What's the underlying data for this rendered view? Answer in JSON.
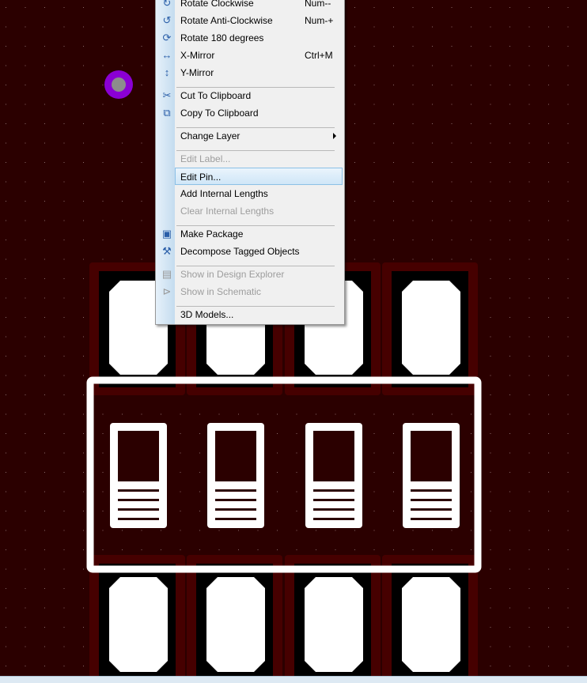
{
  "colors": {
    "background": "#2b0000",
    "pad_outer": "#460000",
    "pad_mask": "#000000",
    "copper": "#ffffff",
    "via": "#8a00d4",
    "via_hole": "#8c8c8c",
    "grid_dot": "#8a6a6a"
  },
  "context_menu": {
    "items": [
      {
        "label": "Rotate Clockwise",
        "shortcut": "Num--",
        "icon": "rotate-clockwise-icon",
        "enabled": true
      },
      {
        "label": "Rotate Anti-Clockwise",
        "shortcut": "Num-+",
        "icon": "rotate-anticlockwise-icon",
        "enabled": true
      },
      {
        "label": "Rotate 180 degrees",
        "shortcut": "",
        "icon": "rotate-180-icon",
        "enabled": true
      },
      {
        "label": "X-Mirror",
        "shortcut": "Ctrl+M",
        "icon": "x-mirror-icon",
        "enabled": true
      },
      {
        "label": "Y-Mirror",
        "shortcut": "",
        "icon": "y-mirror-icon",
        "enabled": true
      },
      {
        "label": "Cut To Clipboard",
        "shortcut": "",
        "icon": "scissors-icon",
        "enabled": true
      },
      {
        "label": "Copy To Clipboard",
        "shortcut": "",
        "icon": "copy-icon",
        "enabled": true
      },
      {
        "label": "Change Layer",
        "shortcut": "",
        "icon": "",
        "enabled": true,
        "submenu": true
      },
      {
        "label": "Edit Label...",
        "shortcut": "",
        "icon": "",
        "enabled": false
      },
      {
        "label": "Edit Pin...",
        "shortcut": "",
        "icon": "",
        "enabled": true,
        "highlighted": true
      },
      {
        "label": "Add Internal Lengths",
        "shortcut": "",
        "icon": "",
        "enabled": true
      },
      {
        "label": "Clear Internal Lengths",
        "shortcut": "",
        "icon": "",
        "enabled": false
      },
      {
        "label": "Make Package",
        "shortcut": "",
        "icon": "make-package-icon",
        "enabled": true
      },
      {
        "label": "Decompose Tagged Objects",
        "shortcut": "",
        "icon": "hammer-icon",
        "enabled": true
      },
      {
        "label": "Show in Design Explorer",
        "shortcut": "",
        "icon": "design-explorer-icon",
        "enabled": false
      },
      {
        "label": "Show in Schematic",
        "shortcut": "",
        "icon": "schematic-icon",
        "enabled": false
      },
      {
        "label": "3D Models...",
        "shortcut": "",
        "icon": "",
        "enabled": true
      }
    ]
  }
}
